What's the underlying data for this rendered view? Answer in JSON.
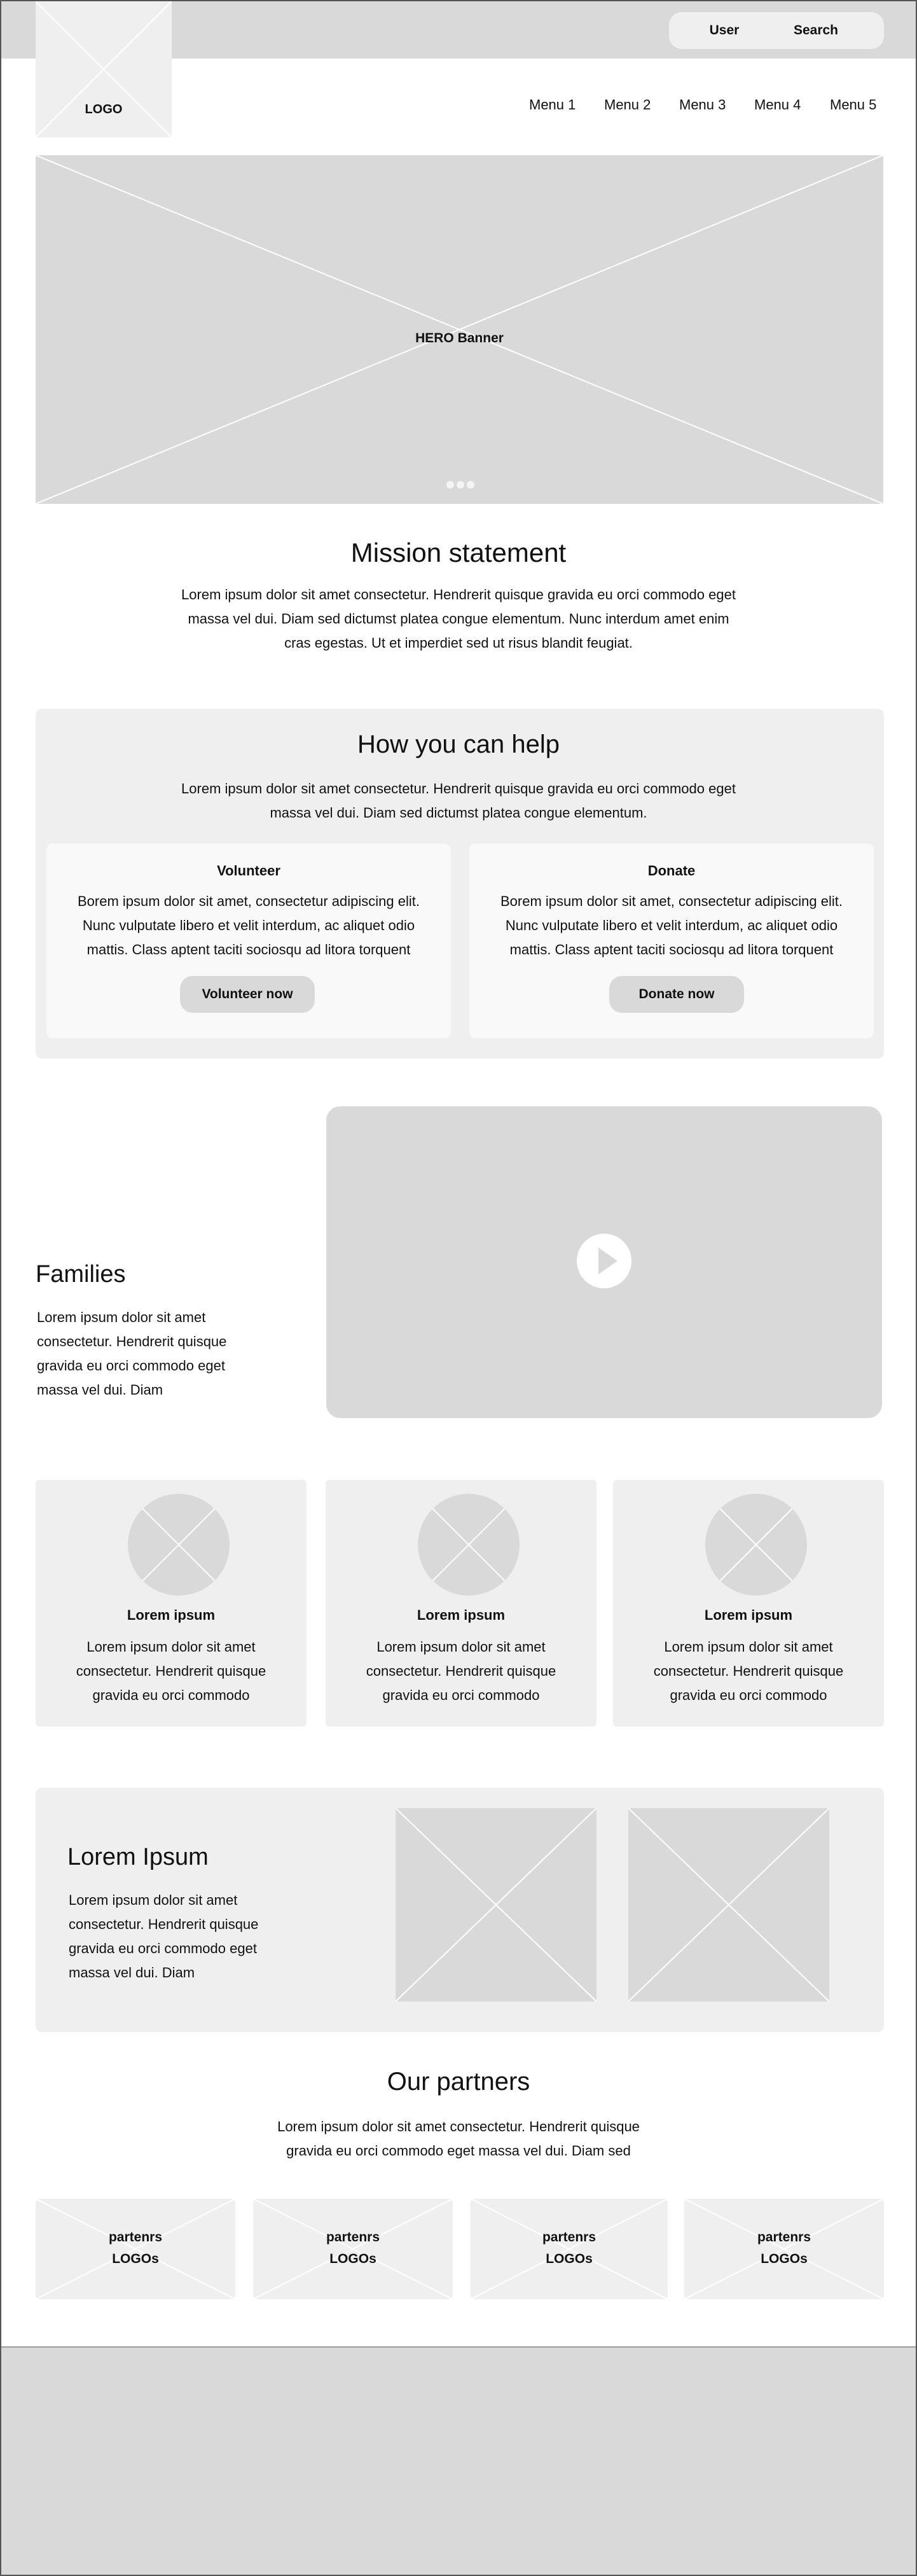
{
  "header": {
    "logo_label": "LOGO",
    "user_label": "User",
    "search_label": "Search",
    "nav": [
      "Menu 1",
      "Menu 2",
      "Menu 3",
      "Menu 4",
      "Menu 5"
    ]
  },
  "hero": {
    "label": "HERO Banner",
    "dots": 3
  },
  "mission": {
    "title": "Mission statement",
    "body_lines": [
      "Lorem ipsum dolor sit amet consectetur. Hendrerit quisque gravida eu orci commodo eget",
      "massa vel dui. Diam sed dictumst platea congue elementum. Nunc interdum amet enim",
      "cras egestas. Ut et imperdiet sed ut risus blandit feugiat."
    ]
  },
  "help": {
    "title": "How you can help",
    "body_lines": [
      "Lorem ipsum dolor sit amet consectetur. Hendrerit quisque gravida eu orci commodo eget",
      "massa vel dui. Diam sed dictumst platea congue elementum."
    ],
    "cards": [
      {
        "title": "Volunteer",
        "body_lines": [
          "Borem ipsum dolor sit amet, consectetur adipiscing elit.",
          "Nunc vulputate libero et velit interdum, ac aliquet odio",
          "mattis. Class aptent taciti sociosqu ad litora torquent"
        ],
        "button": "Volunteer now"
      },
      {
        "title": "Donate",
        "body_lines": [
          "Borem ipsum dolor sit amet, consectetur adipiscing elit.",
          "Nunc vulputate libero et velit interdum, ac aliquet odio",
          "mattis. Class aptent taciti sociosqu ad litora torquent"
        ],
        "button": "Donate now"
      }
    ]
  },
  "families": {
    "title": "Families",
    "body_lines": [
      "Lorem ipsum dolor sit amet",
      "consectetur. Hendrerit quisque",
      "gravida eu orci commodo eget",
      "massa vel dui. Diam"
    ]
  },
  "features": [
    {
      "title": "Lorem ipsum",
      "body_lines": [
        "Lorem ipsum dolor sit amet",
        "consectetur. Hendrerit quisque",
        "gravida eu orci commodo"
      ]
    },
    {
      "title": "Lorem ipsum",
      "body_lines": [
        "Lorem ipsum dolor sit amet",
        "consectetur. Hendrerit quisque",
        "gravida eu orci commodo"
      ]
    },
    {
      "title": "Lorem ipsum",
      "body_lines": [
        "Lorem ipsum dolor sit amet",
        "consectetur. Hendrerit quisque",
        "gravida eu orci commodo"
      ]
    }
  ],
  "lorem_section": {
    "title": "Lorem Ipsum",
    "body_lines": [
      "Lorem ipsum dolor sit amet",
      "consectetur. Hendrerit quisque",
      "gravida eu orci commodo eget",
      "massa vel dui. Diam"
    ]
  },
  "partners": {
    "title": "Our partners",
    "body_lines": [
      "Lorem ipsum dolor sit amet consectetur. Hendrerit quisque",
      "gravida eu orci commodo eget massa vel dui. Diam sed"
    ],
    "logos": [
      {
        "line1": "partenrs",
        "line2": "LOGOs"
      },
      {
        "line1": "partenrs",
        "line2": "LOGOs"
      },
      {
        "line1": "partenrs",
        "line2": "LOGOs"
      },
      {
        "line1": "partenrs",
        "line2": "LOGOs"
      }
    ]
  },
  "colors": {
    "placeholder_gray": "#d9d9d9",
    "panel_gray": "#efefef",
    "card_white": "#f9f9f9",
    "text": "#111111"
  }
}
